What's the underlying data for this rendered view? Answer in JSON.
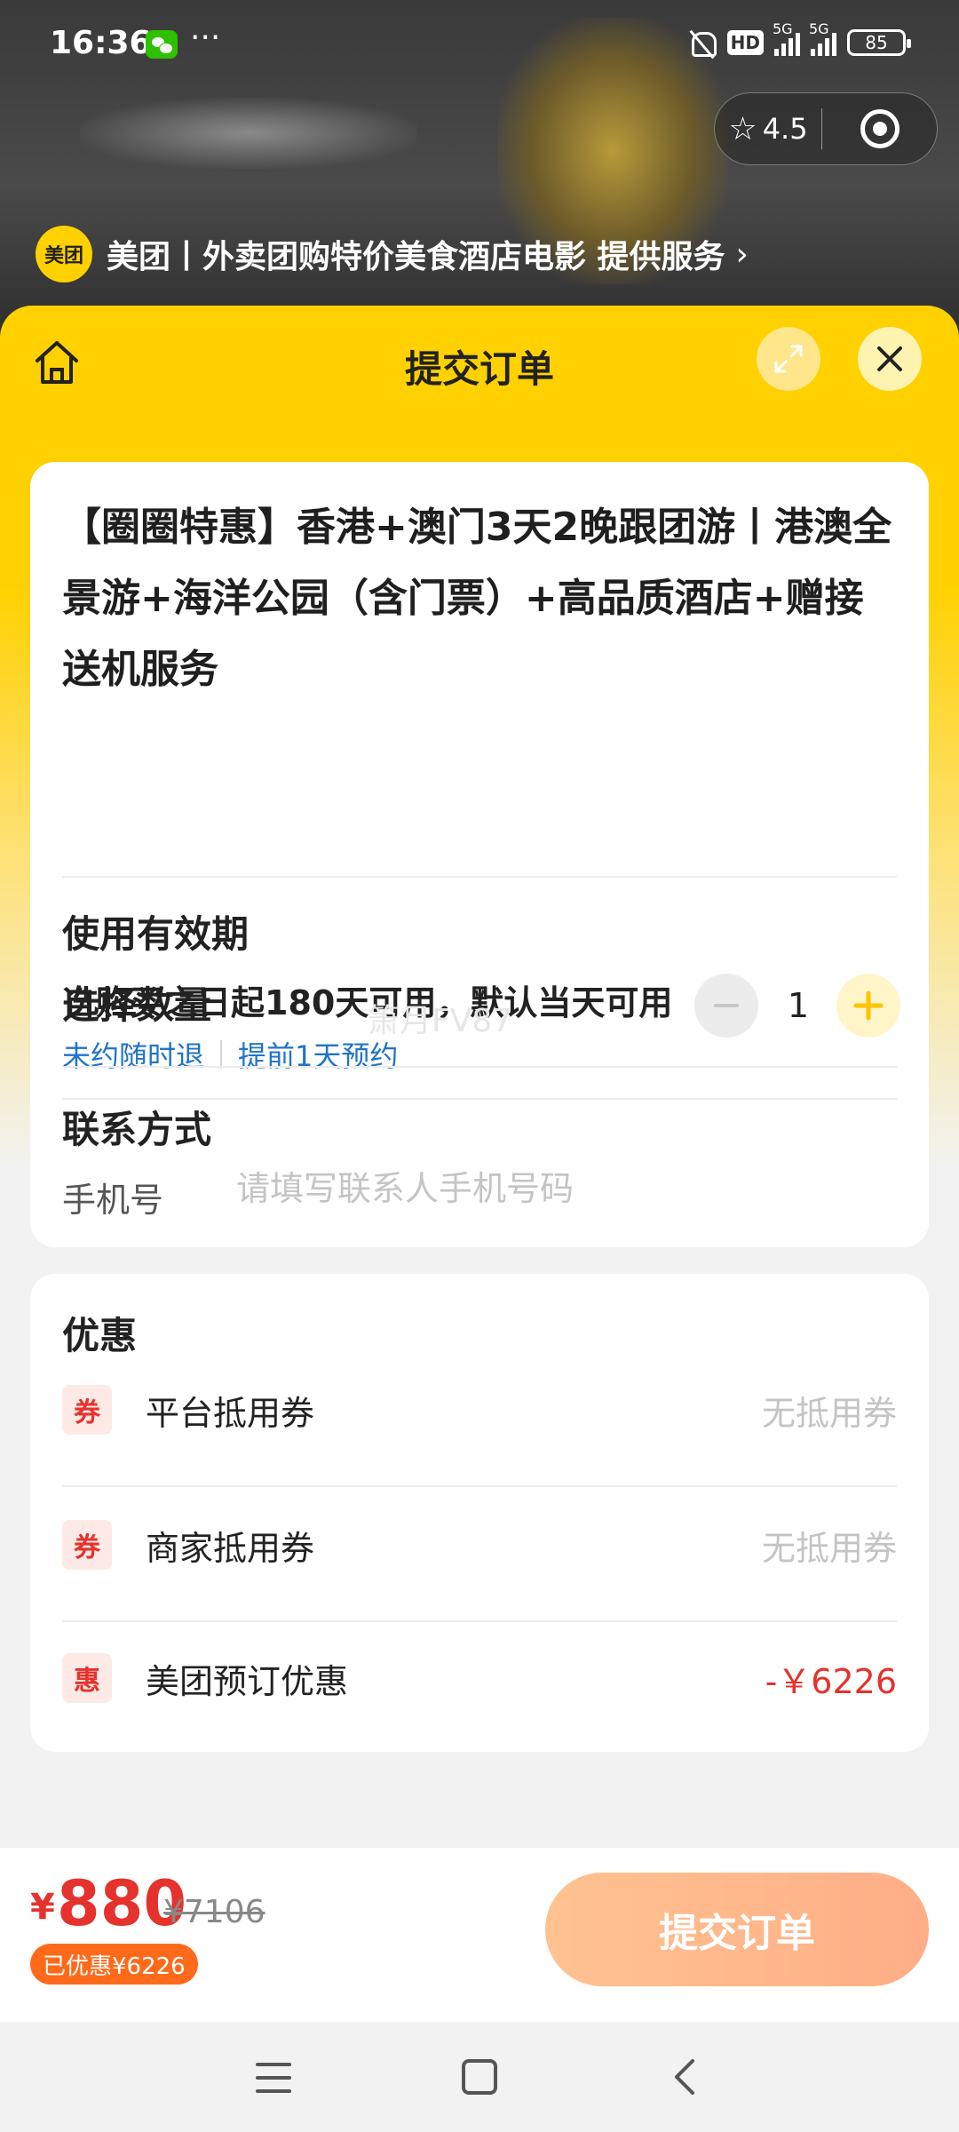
{
  "status_bar": {
    "time": "16:36",
    "more": "···",
    "hd": "HD",
    "net1": "5G",
    "net2": "5G",
    "battery": "85"
  },
  "capsule": {
    "rating": "4.5"
  },
  "provider": {
    "logo_text": "美团",
    "text": "美团丨外卖团购特价美食酒店电影 提供服务",
    "chevron": "›"
  },
  "header": {
    "title": "提交订单"
  },
  "product": {
    "title": "【圈圈特惠】香港+澳门3天2晚跟团游丨港澳全景游+海洋公园（含门票）+高品质酒店+赠接送机服务",
    "validity_label": "使用有效期",
    "validity_text": "自购买之日起180天可用，默认当天可用",
    "tag1": "未约随时退",
    "tag2": "提前1天预约"
  },
  "quantity": {
    "label": "选择数量",
    "value": "1",
    "watermark": "箫月FV87"
  },
  "contact": {
    "label": "联系方式",
    "phone_label": "手机号",
    "phone_placeholder": "请填写联系人手机号码"
  },
  "discounts": {
    "title": "优惠",
    "items": [
      {
        "badge": "券",
        "name": "平台抵用券",
        "value": "无抵用券"
      },
      {
        "badge": "券",
        "name": "商家抵用券",
        "value": "无抵用券"
      },
      {
        "badge": "惠",
        "name": "美团预订优惠",
        "value": "-￥6226"
      }
    ]
  },
  "bottom": {
    "currency": "¥",
    "price": "880",
    "original_price": "¥7106",
    "saved": "已优惠¥6226",
    "submit_label": "提交订单"
  },
  "colors": {
    "brand_yellow": "#ffd100",
    "price_red": "#e5322d",
    "link_blue": "#1f74c9",
    "submit_orange": "#ffae87"
  },
  "icons": [
    "home-icon",
    "expand-icon",
    "close-icon",
    "minus-icon",
    "plus-icon",
    "target-icon",
    "star-icon"
  ]
}
